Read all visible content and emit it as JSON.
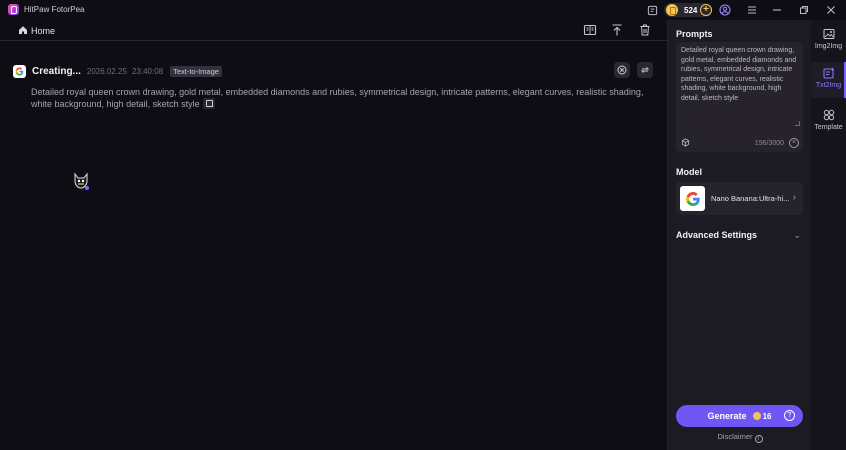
{
  "app": {
    "title": "HitPaw FotorPea"
  },
  "titlebar": {
    "coins": "524"
  },
  "nav": {
    "home_label": "Home"
  },
  "task": {
    "status": "Creating...",
    "date": "2026.02.25",
    "time": "23:40:08",
    "mode": "Text-to-Image",
    "prompt": "Detailed royal queen crown drawing, gold metal, embedded diamonds and rubies, symmetrical design, intricate patterns, elegant curves, realistic shading, white background, high detail, sketch style"
  },
  "panel": {
    "prompts_title": "Prompts",
    "prompt_value": "Detailed royal queen crown drawing, gold metal, embedded diamonds and rubies, symmetrical design, intricate patterns, elegant curves, realistic shading, white background, high detail, sketch style",
    "char_count": "196/3000",
    "model_title": "Model",
    "model_name": "Nano Banana:Ultra-hi...",
    "advanced_label": "Advanced Settings",
    "generate_label": "Generate",
    "generate_cost": "16",
    "disclaimer": "Disclaimer"
  },
  "rail": {
    "items": [
      {
        "label": "Img2Img"
      },
      {
        "label": "Txt2Img"
      },
      {
        "label": "Template"
      }
    ]
  },
  "colors": {
    "accent": "#6f57f5",
    "coin": "#f3c453",
    "background": "#0f0d14",
    "panel": "#1c1a22"
  }
}
